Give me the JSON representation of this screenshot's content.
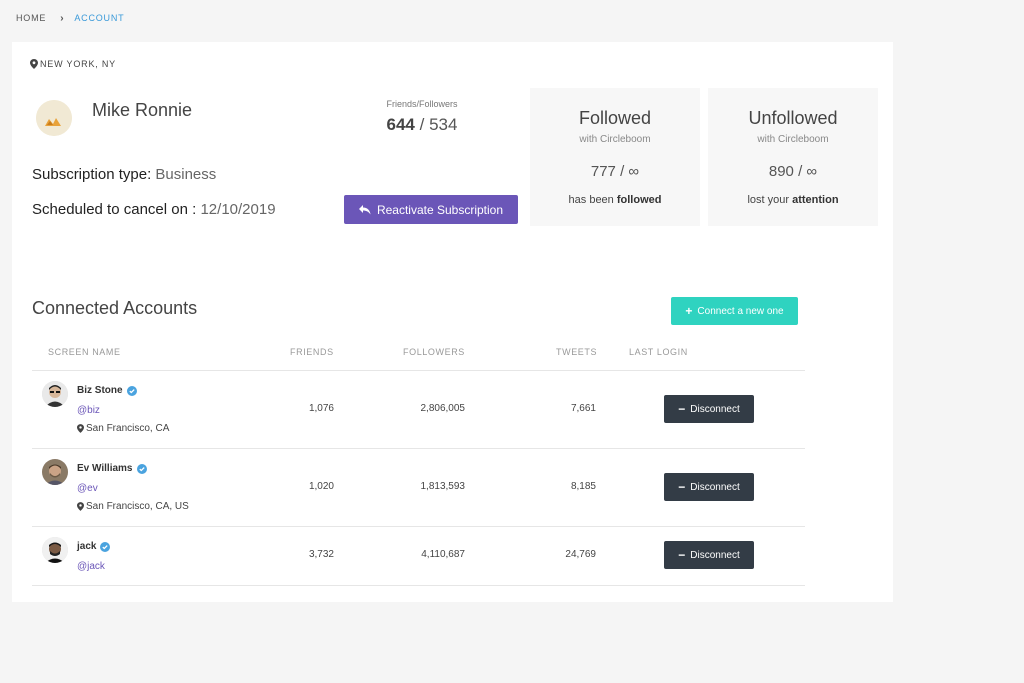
{
  "breadcrumb": {
    "home": "HOME",
    "current": "ACCOUNT"
  },
  "profile": {
    "location": "NEW YORK, NY",
    "name": "Mike Ronnie",
    "ff_label": "Friends/Followers",
    "friends": "644",
    "followers": "534",
    "ff_sep": "/",
    "subscription_label": "Subscription type:",
    "subscription_value": "Business",
    "cancel_label": "Scheduled to cancel on :",
    "cancel_value": "12/10/2019",
    "reactivate_label": "Reactivate Subscription"
  },
  "stats": {
    "followed": {
      "title": "Followed",
      "sub": "with Circleboom",
      "count": "777 / ∞",
      "note_prefix": "has been",
      "note_bold": "followed"
    },
    "unfollowed": {
      "title": "Unfollowed",
      "sub": "with Circleboom",
      "count": "890 / ∞",
      "note_prefix": "lost your",
      "note_bold": "attention"
    }
  },
  "connected": {
    "title": "Connected Accounts",
    "connect_label": "Connect a new one",
    "columns": [
      "SCREEN NAME",
      "FRIENDS",
      "FOLLOWERS",
      "TWEETS",
      "LAST LOGIN"
    ],
    "disconnect_label": "Disconnect",
    "rows": [
      {
        "name": "Biz Stone",
        "handle": "@biz",
        "location": "San Francisco, CA",
        "friends": "1,076",
        "followers": "2,806,005",
        "tweets": "7,661"
      },
      {
        "name": "Ev Williams",
        "handle": "@ev",
        "location": "San Francisco, CA, US",
        "friends": "1,020",
        "followers": "1,813,593",
        "tweets": "8,185"
      },
      {
        "name": "jack",
        "handle": "@jack",
        "location": "",
        "friends": "3,732",
        "followers": "4,110,687",
        "tweets": "24,769"
      }
    ]
  },
  "colors": {
    "accent_purple": "#6b56b8",
    "accent_teal": "#2fd3c0",
    "link_blue": "#3b9ad9",
    "dark_button": "#333c46",
    "verified_blue": "#4aa3df"
  },
  "icons": {
    "separator": "chevron-right-icon",
    "location": "map-pin-icon",
    "reactivate": "reply-arrow-icon",
    "connect": "plus-icon",
    "disconnect": "minus-icon",
    "verified": "verified-badge-icon"
  }
}
